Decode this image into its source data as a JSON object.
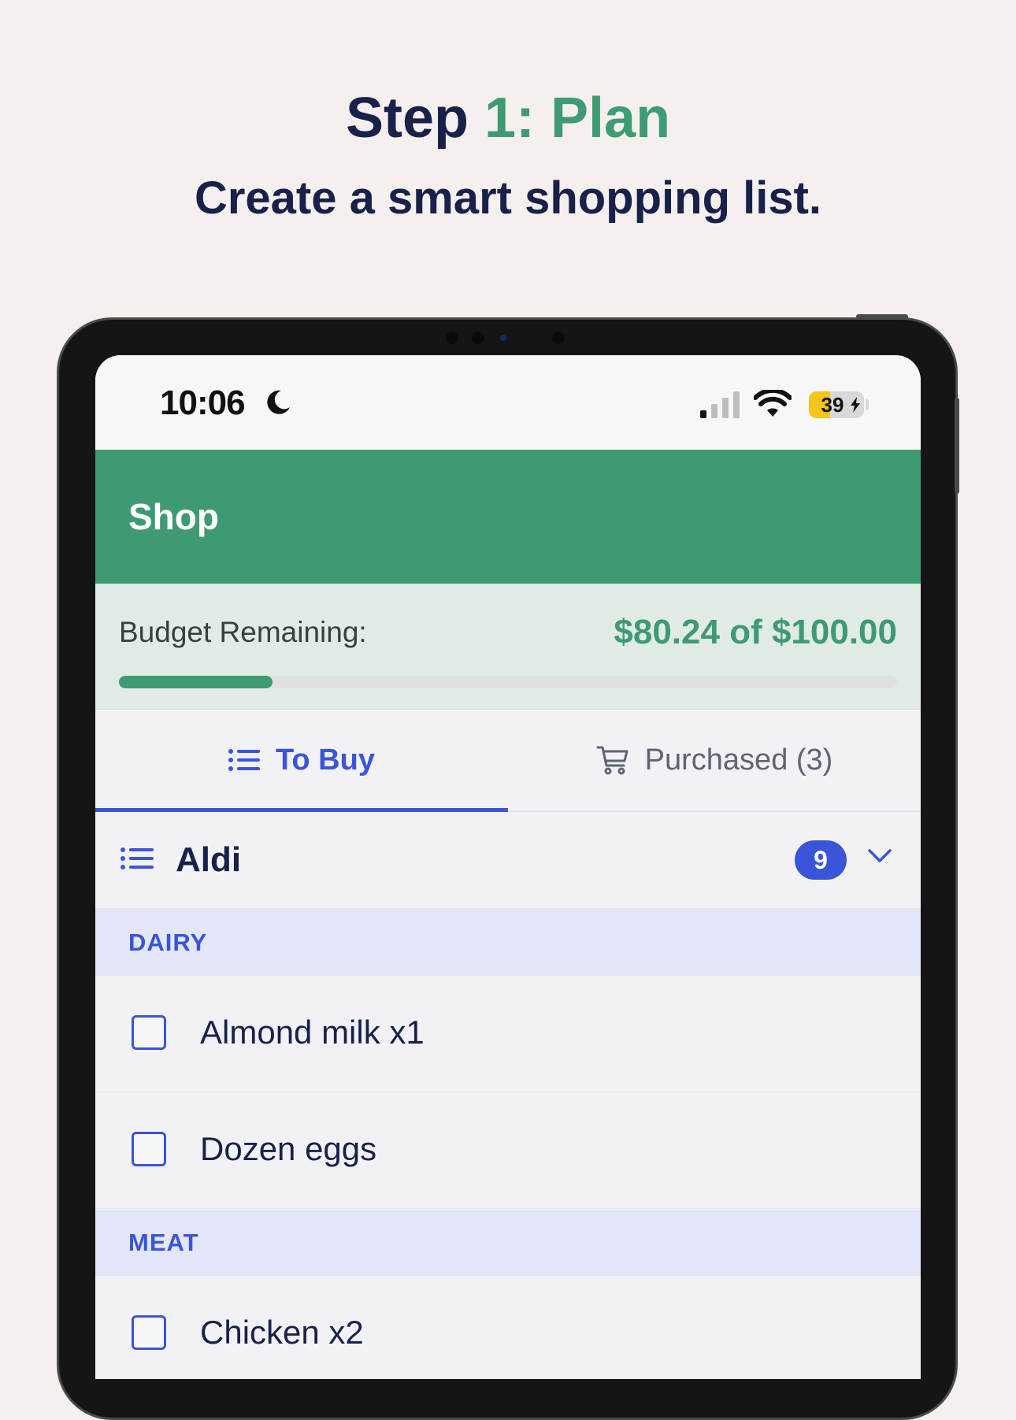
{
  "promo": {
    "title_prefix": "Step ",
    "title_accent": "1: Plan",
    "subtitle": "Create a smart shopping list."
  },
  "status_bar": {
    "time": "10:06",
    "battery": "39",
    "battery_level": 0.39,
    "icons": [
      "moon-icon",
      "signal-icon",
      "wifi-icon",
      "battery-icon"
    ]
  },
  "app_bar": {
    "title": "Shop"
  },
  "budget": {
    "label": "Budget Remaining:",
    "value": "$80.24 of $100.00",
    "spent_fraction": 0.1976
  },
  "tabs": [
    {
      "label": "To Buy",
      "icon": "list-icon",
      "active": true
    },
    {
      "label": "Purchased (3)",
      "icon": "cart-icon",
      "active": false
    }
  ],
  "store": {
    "name": "Aldi",
    "count": "9",
    "icon": "list-icon"
  },
  "categories": [
    {
      "name": "DAIRY",
      "items": [
        "Almond milk x1",
        "Dozen eggs"
      ]
    },
    {
      "name": "MEAT",
      "items": [
        "Chicken x2"
      ]
    }
  ],
  "colors": {
    "brand_green": "#3f9a74",
    "accent_blue": "#3a55d8",
    "navy": "#17214a",
    "page_bg": "#f5f0ee"
  }
}
